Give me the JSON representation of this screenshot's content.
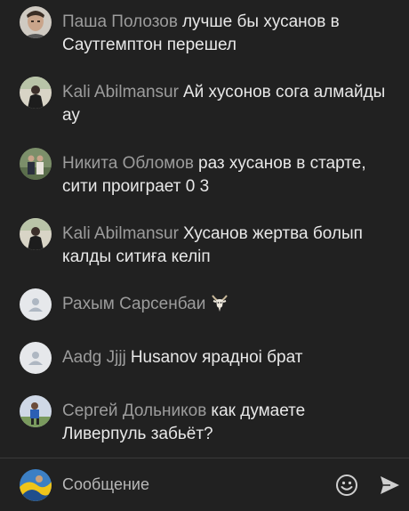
{
  "messages": [
    {
      "author": "Паша Полозов",
      "text": "лучше бы хусанов в Саутгемптон перешел",
      "avatar_icon": "user-photo-icon"
    },
    {
      "author": "Kali Abilmansur",
      "text": "Ай хусонов сога алмайды ау",
      "avatar_icon": "user-photo-icon"
    },
    {
      "author": "Никита Обломов",
      "text": "раз хусанов в старте, сити проиграет 0 3",
      "avatar_icon": "user-photo-icon"
    },
    {
      "author": "Kali Abilmansur",
      "text": "Хусанов жертва болып калды ситиға келіп",
      "avatar_icon": "user-photo-icon"
    },
    {
      "author": "Рахым Сарсенбаи",
      "text": "",
      "avatar_icon": "default-user-icon",
      "emoji": "goat-emoji-icon"
    },
    {
      "author": "Aadg Jjjj",
      "text": "Husanov ярадноі брат",
      "avatar_icon": "default-user-icon"
    },
    {
      "author": "Сергей Дольников",
      "text": "как думаете Ливерпуль забьёт?",
      "avatar_icon": "user-photo-icon"
    }
  ],
  "composer": {
    "placeholder": "Сообщение",
    "emoji_icon": "smile-icon",
    "send_icon": "send-arrow-icon"
  },
  "colors": {
    "background": "#212121",
    "author": "#9c9c9c",
    "text": "#e8e8e8",
    "default_avatar": "#e6e8eb"
  }
}
